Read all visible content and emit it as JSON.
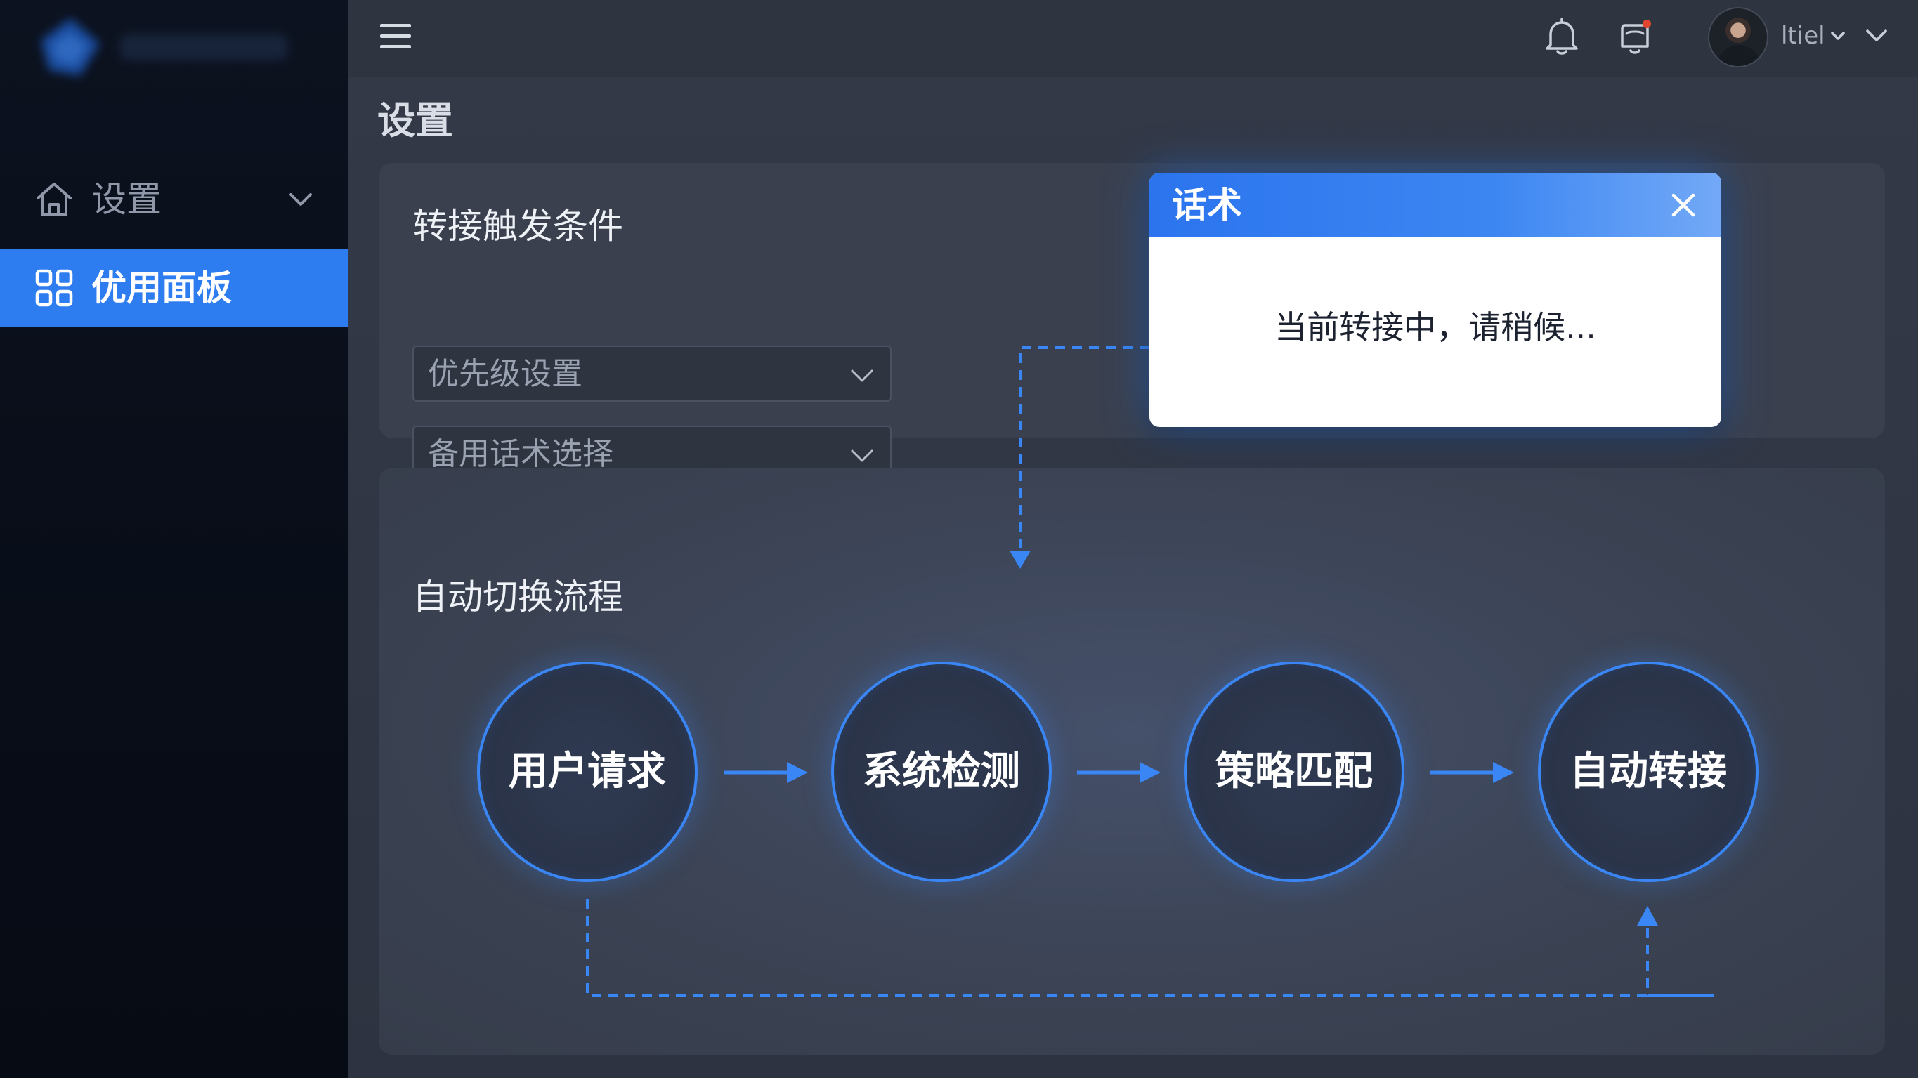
{
  "sidebar": {
    "logo_icon": "blurred-logo",
    "items": [
      {
        "label": "设置",
        "icon": "home-icon",
        "expanded": false
      },
      {
        "label": "优用面板",
        "icon": "grid-icon",
        "active": true
      }
    ]
  },
  "topbar": {
    "menu_icon": "hamburger-icon",
    "bell_icon": "bell-icon",
    "notification_icon": "notification-icon",
    "username": "ltiel"
  },
  "page": {
    "title": "设置"
  },
  "trigger_card": {
    "title": "转接触发条件",
    "selects": [
      {
        "label": "优先级设置"
      },
      {
        "label": "备用话术选择"
      }
    ]
  },
  "flow_card": {
    "title": "自动切换流程",
    "steps": [
      "用户请求",
      "系统检测",
      "策略匹配",
      "自动转接"
    ]
  },
  "dialog": {
    "title": "话术",
    "message": "当前转接中，请稍候..."
  },
  "colors": {
    "accent": "#2d7cf0",
    "sidebar_bg": "#0a0f1b",
    "main_bg": "#2f3441",
    "card_bg": "#3a404e",
    "node_border": "#3a86f5",
    "notification_dot": "#e0452f"
  }
}
